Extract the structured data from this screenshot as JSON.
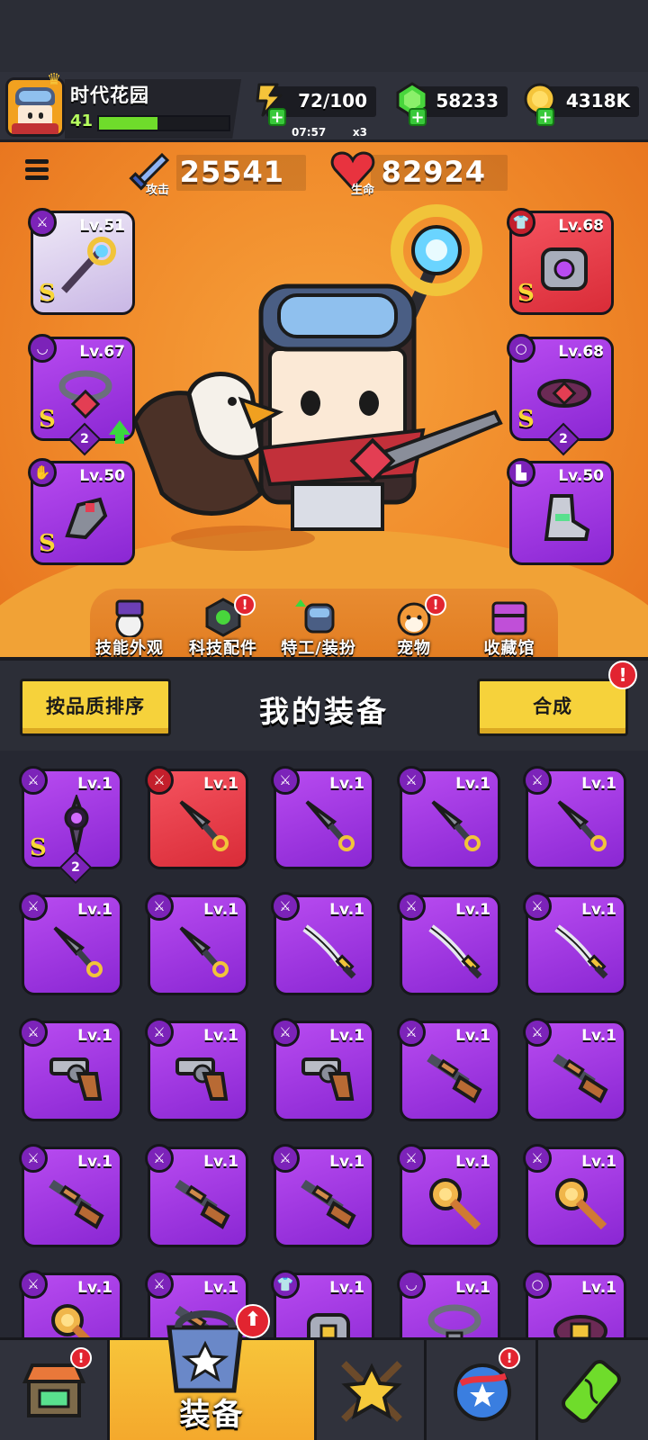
{
  "player": {
    "name": "时代花园",
    "level": "41",
    "xp_fraction": 0.45
  },
  "resources": {
    "energy": {
      "value": "72/100",
      "timer": "07:57",
      "multiplier": "x3",
      "icon": "energy-bolt-icon"
    },
    "gems": {
      "value": "58233",
      "icon": "green-gem-icon"
    },
    "coins": {
      "value": "4318K",
      "icon": "gold-coin-icon"
    }
  },
  "stats": {
    "attack": {
      "label": "攻击",
      "value": "25541",
      "icon": "sword-icon"
    },
    "health": {
      "label": "生命",
      "value": "82924",
      "icon": "heart-icon"
    }
  },
  "equipped": [
    {
      "slot": "weapon",
      "level": "Lv.51",
      "grade": "S",
      "color": "white",
      "category_icon": "weapon-icon",
      "item_icon": "gear-staff-icon"
    },
    {
      "slot": "armor",
      "level": "Lv.68",
      "grade": "S",
      "color": "red",
      "category_icon": "armor-icon",
      "item_icon": "robot-armor-icon"
    },
    {
      "slot": "necklace",
      "level": "Lv.67",
      "grade": "S",
      "color": "purple",
      "category_icon": "necklace-icon",
      "item_icon": "chain-necklace-icon",
      "stars": "2",
      "upgrade": true
    },
    {
      "slot": "belt",
      "level": "Lv.68",
      "grade": "S",
      "color": "purple",
      "category_icon": "belt-icon",
      "item_icon": "gem-belt-icon",
      "stars": "2"
    },
    {
      "slot": "gloves",
      "level": "Lv.50",
      "grade": "S",
      "color": "purple",
      "category_icon": "glove-icon",
      "item_icon": "mech-glove-icon"
    },
    {
      "slot": "boots",
      "level": "Lv.50",
      "grade": "",
      "color": "purple",
      "category_icon": "boot-icon",
      "item_icon": "mech-boot-icon"
    }
  ],
  "features": [
    {
      "label": "技能外观",
      "icon": "skill-skin-icon",
      "badge": false
    },
    {
      "label": "科技配件",
      "icon": "tech-part-icon",
      "badge": true
    },
    {
      "label": "特工/装扮",
      "icon": "agent-costume-icon",
      "badge": false,
      "upgrade": true
    },
    {
      "label": "宠物",
      "icon": "shiba-pet-icon",
      "badge": true
    },
    {
      "label": "收藏馆",
      "icon": "collection-chest-icon",
      "badge": false
    }
  ],
  "inventory_header": {
    "sort_label": "按品质排序",
    "title": "我的装备",
    "merge_label": "合成",
    "merge_badge": "!"
  },
  "inventory": [
    {
      "level": "Lv.1",
      "color": "purple",
      "item": "dark-orb-dagger",
      "grade": "S",
      "stars": "2"
    },
    {
      "level": "Lv.1",
      "color": "red",
      "item": "kunai"
    },
    {
      "level": "Lv.1",
      "color": "purple",
      "item": "kunai"
    },
    {
      "level": "Lv.1",
      "color": "purple",
      "item": "kunai"
    },
    {
      "level": "Lv.1",
      "color": "purple",
      "item": "kunai"
    },
    {
      "level": "Lv.1",
      "color": "purple",
      "item": "kunai"
    },
    {
      "level": "Lv.1",
      "color": "purple",
      "item": "kunai"
    },
    {
      "level": "Lv.1",
      "color": "purple",
      "item": "katana"
    },
    {
      "level": "Lv.1",
      "color": "purple",
      "item": "katana"
    },
    {
      "level": "Lv.1",
      "color": "purple",
      "item": "katana"
    },
    {
      "level": "Lv.1",
      "color": "purple",
      "item": "revolver"
    },
    {
      "level": "Lv.1",
      "color": "purple",
      "item": "revolver"
    },
    {
      "level": "Lv.1",
      "color": "purple",
      "item": "revolver"
    },
    {
      "level": "Lv.1",
      "color": "purple",
      "item": "shotgun"
    },
    {
      "level": "Lv.1",
      "color": "purple",
      "item": "shotgun"
    },
    {
      "level": "Lv.1",
      "color": "purple",
      "item": "shotgun"
    },
    {
      "level": "Lv.1",
      "color": "purple",
      "item": "shotgun"
    },
    {
      "level": "Lv.1",
      "color": "purple",
      "item": "shotgun"
    },
    {
      "level": "Lv.1",
      "color": "purple",
      "item": "drill-staff"
    },
    {
      "level": "Lv.1",
      "color": "purple",
      "item": "drill-staff"
    },
    {
      "level": "Lv.1",
      "color": "purple",
      "item": "drill-staff"
    },
    {
      "level": "Lv.1",
      "color": "purple",
      "item": "shotgun"
    },
    {
      "level": "Lv.1",
      "color": "purple",
      "item": "armor",
      "category": "armor"
    },
    {
      "level": "Lv.1",
      "color": "purple",
      "item": "necklace",
      "category": "necklace"
    },
    {
      "level": "Lv.1",
      "color": "purple",
      "item": "belt",
      "category": "belt"
    }
  ],
  "bottom_nav": [
    {
      "label": "",
      "icon": "shop-icon",
      "badge": true,
      "active": false
    },
    {
      "label": "装备",
      "icon": "equipment-icon",
      "badge": false,
      "active": true,
      "upgrade": true
    },
    {
      "label": "",
      "icon": "crossed-swords-star-icon",
      "badge": false,
      "active": false
    },
    {
      "label": "",
      "icon": "star-planet-icon",
      "badge": true,
      "active": false
    },
    {
      "label": "",
      "icon": "dna-capsule-icon",
      "badge": false,
      "active": false
    }
  ],
  "colors": {
    "purple": "#9a32e0",
    "red": "#e63c48",
    "gold": "#f6d23b",
    "hero_bg": "#f08a2a"
  }
}
